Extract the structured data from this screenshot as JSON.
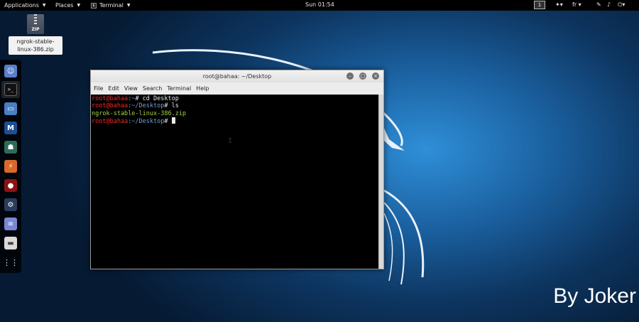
{
  "top_panel": {
    "applications": "Applications",
    "places": "Places",
    "terminal": "Terminal",
    "clock": "Sun 01:54",
    "workspace": "1",
    "keyboard_layout": "fr",
    "icons": [
      "users-icon",
      "keyboard-layout-icon",
      "tool-icon",
      "volume-icon",
      "power-icon"
    ]
  },
  "desktop": {
    "file_icon_label": "ZIP",
    "file_name": "ngrok-stable-linux-386.zip"
  },
  "dock": {
    "items": [
      "pidgin-icon",
      "terminal-icon",
      "files-icon",
      "metasploit-icon",
      "armitage-icon",
      "burpsuite-icon",
      "faraday-icon",
      "maltego-icon",
      "leafpad-icon",
      "disk-icon",
      "show-apps-icon"
    ]
  },
  "window": {
    "title": "root@bahaa: ~/Desktop",
    "menu": [
      "File",
      "Edit",
      "View",
      "Search",
      "Terminal",
      "Help"
    ]
  },
  "terminal": {
    "lines": [
      {
        "user": "root@bahaa",
        "path": ":~",
        "cmd": "# cd Desktop"
      },
      {
        "user": "root@bahaa",
        "path": ":~/Desktop",
        "cmd": "# ls"
      },
      {
        "output": "ngrok-stable-linux-386.zip"
      },
      {
        "user": "root@bahaa",
        "path": ":~/Desktop",
        "cmd": "# "
      }
    ]
  },
  "watermark": "By Joker",
  "colors": {
    "prompt_user": "#ef2929",
    "prompt_path": "#729fcf",
    "zip_file": "#a3d14a",
    "terminal_bg": "#000000"
  }
}
